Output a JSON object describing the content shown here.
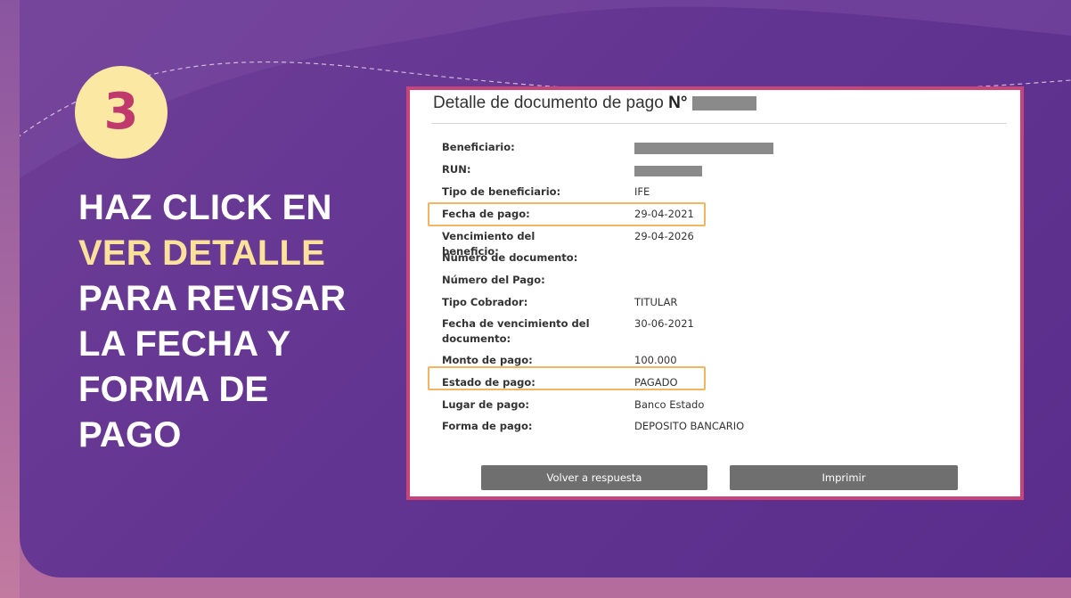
{
  "step": {
    "number": "3"
  },
  "headline": {
    "line1": "HAZ CLICK EN",
    "line2_highlight": "VER DETALLE",
    "line3": "PARA REVISAR",
    "line4": "LA FECHA Y",
    "line5": "FORMA DE PAGO"
  },
  "colors": {
    "accent_pink": "#c8457a",
    "highlight_yellow": "#fbe19a",
    "highlight_box": "#f2b560",
    "panel_purple": "#633592"
  },
  "document": {
    "title": "Detalle de documento de pago",
    "title_suffix": "N°",
    "rows": [
      {
        "label": "Beneficiario:",
        "value": ""
      },
      {
        "label": "RUN:",
        "value": ""
      },
      {
        "label": "Tipo de beneficiario:",
        "value": "IFE"
      },
      {
        "label": "Fecha de pago:",
        "value": "29-04-2021"
      },
      {
        "label": "Vencimiento del beneficio:",
        "value": "29-04-2026"
      },
      {
        "label": "Número de documento:",
        "value": ""
      },
      {
        "label": "Número del Pago:",
        "value": ""
      },
      {
        "label": "Tipo Cobrador:",
        "value": "TITULAR"
      },
      {
        "label": "Fecha de vencimiento del documento:",
        "value": "30-06-2021"
      },
      {
        "label": "Monto de pago:",
        "value": "100.000"
      },
      {
        "label": "Estado de pago:",
        "value": "PAGADO"
      },
      {
        "label": "Lugar de pago:",
        "value": "Banco Estado"
      },
      {
        "label": "Forma de pago:",
        "value": "DEPOSITO BANCARIO"
      }
    ],
    "buttons": {
      "back": "Volver a respuesta",
      "print": "Imprimir"
    }
  }
}
